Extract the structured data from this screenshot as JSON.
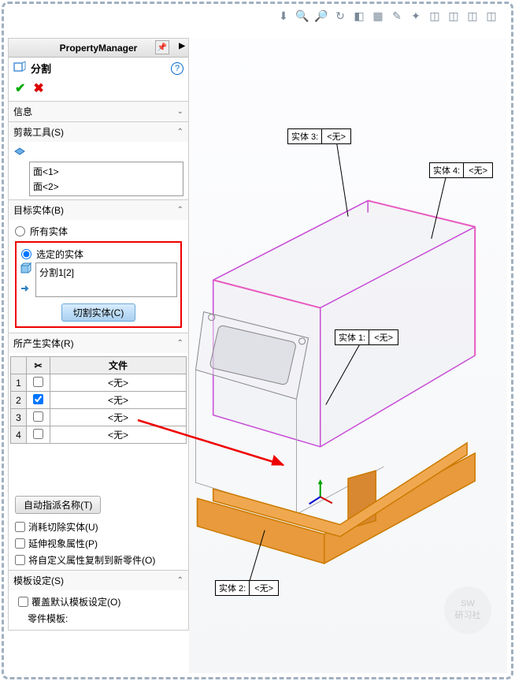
{
  "pm": {
    "header": "PropertyManager",
    "feature_title": "分割",
    "info_label": "信息",
    "trim_tools_label": "剪裁工具(S)",
    "trim_faces": [
      "面<1>",
      "面<2>"
    ],
    "target_bodies_label": "目标实体(B)",
    "all_bodies": "所有实体",
    "selected_bodies": "选定的实体",
    "selected_item": "分割1[2]",
    "cut_bodies_btn": "切割实体(C)",
    "resulting_bodies_label": "所产生实体(R)",
    "file_col": "文件",
    "none_val": "<无>",
    "auto_assign_btn": "自动指派名称(T)",
    "consume_cut": "消耗切除实体(U)",
    "propagate_visual": "延伸视象属性(P)",
    "copy_custom": "将自定义属性复制到新零件(O)",
    "template_label": "模板设定(S)",
    "override_template": "覆盖默认模板设定(O)",
    "part_template": "零件模板:"
  },
  "callouts": {
    "b1": {
      "label": "实体 1:",
      "val": "<无>"
    },
    "b2": {
      "label": "实体 2:",
      "val": "<无>"
    },
    "b3": {
      "label": "实体 3:",
      "val": "<无>"
    },
    "b4": {
      "label": "实体 4:",
      "val": "<无>"
    }
  },
  "rows": [
    "1",
    "2",
    "3",
    "4"
  ]
}
